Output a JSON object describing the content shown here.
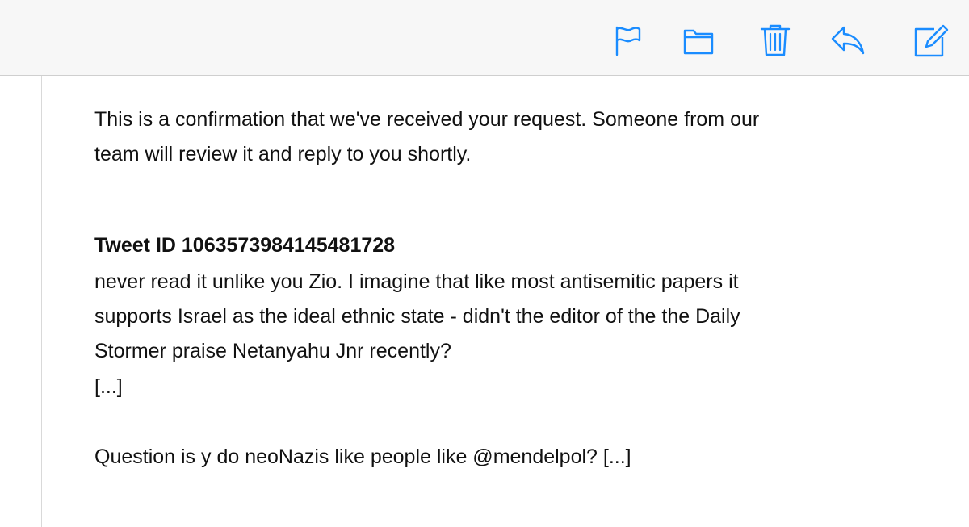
{
  "toolbar": {
    "accent_color": "#1a8cff",
    "icons": [
      "flag-icon",
      "folder-icon",
      "trash-icon",
      "reply-icon",
      "compose-icon"
    ]
  },
  "message": {
    "intro_line1": "This is a confirmation that we've received your request. Someone from our",
    "intro_line2": "team will review it and reply to you shortly.",
    "tweet_heading": "Tweet ID 1063573984145481728",
    "tweet_line1": "never read it unlike you Zio. I imagine that like most antisemitic papers it",
    "tweet_line2": "supports Israel as the ideal ethnic state - didn't the editor of the the Daily",
    "tweet_line3": "Stormer praise Netanyahu Jnr recently?",
    "ellipsis": "[...]",
    "question_line": "Question is y do neoNazis like people like @mendelpol? [...]"
  }
}
